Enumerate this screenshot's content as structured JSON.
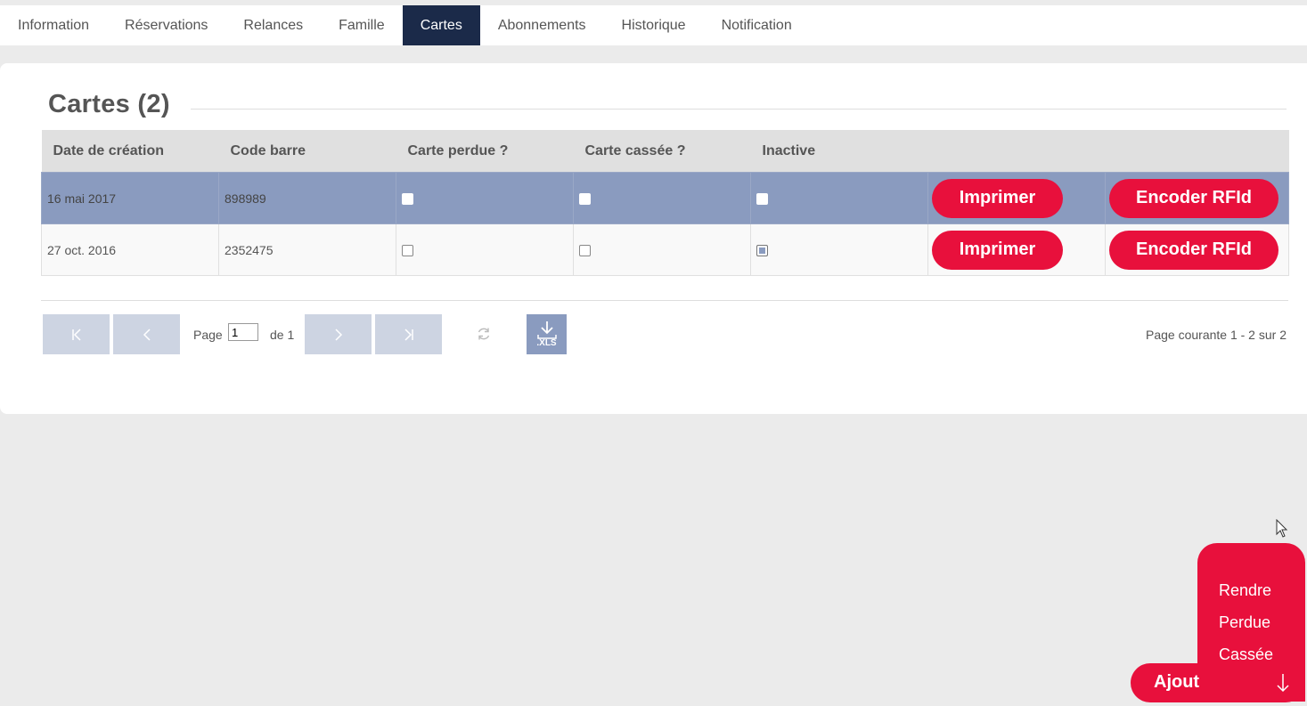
{
  "tabs": [
    {
      "label": "Information",
      "active": false
    },
    {
      "label": "Réservations",
      "active": false
    },
    {
      "label": "Relances",
      "active": false
    },
    {
      "label": "Famille",
      "active": false
    },
    {
      "label": "Cartes",
      "active": true
    },
    {
      "label": "Abonnements",
      "active": false
    },
    {
      "label": "Historique",
      "active": false
    },
    {
      "label": "Notification",
      "active": false
    }
  ],
  "section": {
    "title": "Cartes (2)"
  },
  "table": {
    "headers": [
      "Date de création",
      "Code barre",
      "Carte perdue ?",
      "Carte cassée ?",
      "Inactive"
    ],
    "rows": [
      {
        "date": "16 mai 2017",
        "code": "898989",
        "perdue": false,
        "cassee": false,
        "inactive": false,
        "selected": true,
        "print_label": "Imprimer",
        "rfid_label": "Encoder RFId"
      },
      {
        "date": "27 oct. 2016",
        "code": "2352475",
        "perdue": false,
        "cassee": false,
        "inactive": true,
        "selected": false,
        "print_label": "Imprimer",
        "rfid_label": "Encoder RFId"
      }
    ]
  },
  "pager": {
    "page_label": "Page",
    "page_value": "1",
    "of_label": "de 1",
    "xls_label": ".XLS",
    "info": "Page courante 1 - 2 sur 2"
  },
  "fab": {
    "menu_items": [
      "Rendre",
      "Perdue",
      "Cassée"
    ],
    "main_label": "Ajout"
  },
  "colors": {
    "accent": "#e8103c",
    "active_tab": "#1b2a49",
    "selected_row": "#8a9bbf",
    "pager_button": "#cdd4e2"
  }
}
